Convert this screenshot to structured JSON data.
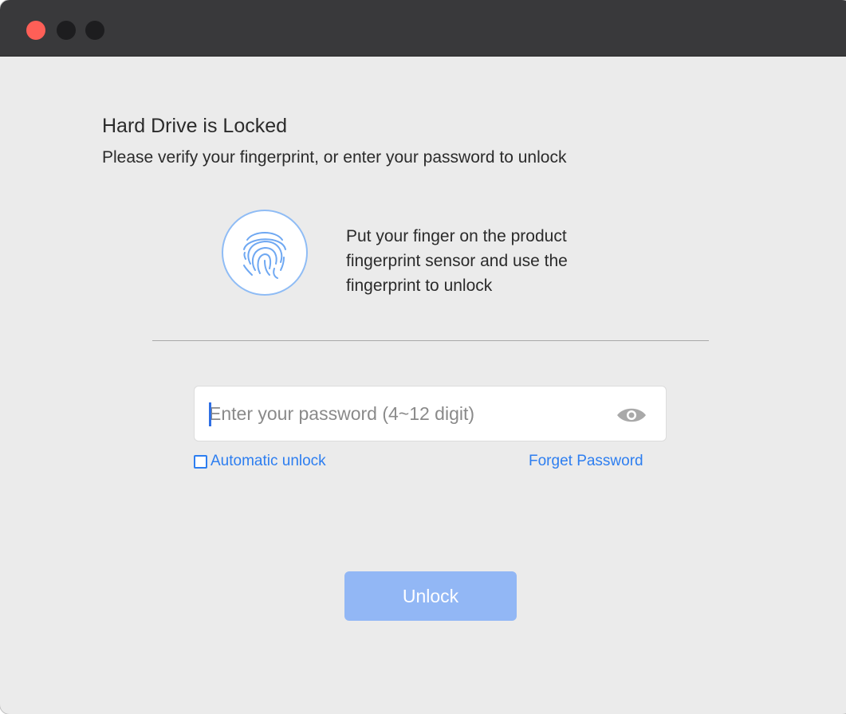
{
  "window": {
    "controls": [
      "close",
      "minimize",
      "maximize"
    ]
  },
  "header": {
    "title": "Hard Drive is Locked",
    "subtitle": "Please verify your fingerprint, or enter your password to unlock"
  },
  "fingerprint": {
    "icon": "fingerprint-icon",
    "instruction_lines": [
      "Put your finger on the product",
      "fingerprint sensor and use the",
      "fingerprint to unlock"
    ]
  },
  "password": {
    "placeholder": "Enter your password (4~12 digit)",
    "value": "",
    "reveal_icon": "eye-icon"
  },
  "options": {
    "auto_unlock_label": "Automatic unlock",
    "auto_unlock_checked": false,
    "forget_label": "Forget Password"
  },
  "actions": {
    "unlock_label": "Unlock",
    "unlock_enabled": false
  },
  "colors": {
    "titlebar": "#39393b",
    "background": "#ebebeb",
    "close": "#fe5f57",
    "accent": "#2d7ef0",
    "button_disabled": "#92b7f5",
    "fingerprint_ring": "#8fbcf5"
  }
}
